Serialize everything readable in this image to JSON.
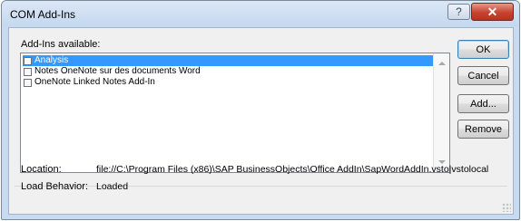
{
  "window": {
    "title": "COM Add-Ins",
    "help_glyph": "?",
    "close_glyph": "✕"
  },
  "addins": {
    "label": "Add-Ins available:",
    "items": [
      {
        "label": "Analysis",
        "checked": false,
        "selected": true
      },
      {
        "label": "Notes OneNote sur des documents Word",
        "checked": false,
        "selected": false
      },
      {
        "label": "OneNote Linked Notes Add-In",
        "checked": false,
        "selected": false
      }
    ]
  },
  "buttons": {
    "ok": "OK",
    "cancel": "Cancel",
    "add": "Add...",
    "remove": "Remove"
  },
  "details": {
    "location_label": "Location:",
    "location_value": "file://C:\\Program Files (x86)\\SAP BusinessObjects\\Office AddIn\\SapWordAddIn.vsto|vstolocal",
    "load_behavior_label": "Load Behavior:",
    "load_behavior_value": "Loaded"
  },
  "icons": {
    "help": "help-icon",
    "close": "close-icon",
    "scroll_up": "scroll-up-arrow-icon",
    "scroll_down": "scroll-down-arrow-icon"
  },
  "colors": {
    "selection": "#3399ff",
    "close_button": "#c8432f",
    "title_bar": "#c5d8ef"
  }
}
